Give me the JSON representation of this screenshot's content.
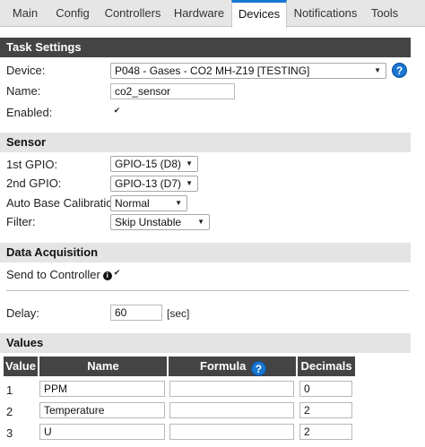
{
  "tabs": [
    {
      "label": "Main",
      "active": false
    },
    {
      "label": "Config",
      "active": false
    },
    {
      "label": "Controllers",
      "active": false
    },
    {
      "label": "Hardware",
      "active": false
    },
    {
      "label": "Devices",
      "active": true
    },
    {
      "label": "Notifications",
      "active": false
    },
    {
      "label": "Tools",
      "active": false
    }
  ],
  "task_settings": {
    "title": "Task Settings",
    "device_label": "Device:",
    "device_value": "P048 - Gases - CO2 MH-Z19 [TESTING]",
    "name_label": "Name:",
    "name_value": "co2_sensor",
    "enabled_label": "Enabled:",
    "enabled_check": "✔"
  },
  "sensor": {
    "title": "Sensor",
    "gpio1_label": "1st GPIO:",
    "gpio1_value": "GPIO-15 (D8)",
    "gpio2_label": "2nd GPIO:",
    "gpio2_value": "GPIO-13 (D7)",
    "abc_label": "Auto Base Calibration:",
    "abc_value": "Normal",
    "filter_label": "Filter:",
    "filter_value": "Skip Unstable"
  },
  "data_acquisition": {
    "title": "Data Acquisition",
    "send_label": "Send to Controller",
    "send_check": "✔",
    "delay_label": "Delay:",
    "delay_value": "60",
    "delay_unit": "[sec]"
  },
  "values": {
    "title": "Values",
    "headers": {
      "value": "Value",
      "name": "Name",
      "formula": "Formula",
      "decimals": "Decimals"
    },
    "rows": [
      {
        "num": "1",
        "name": "PPM",
        "formula": "",
        "decimals": "0"
      },
      {
        "num": "2",
        "name": "Temperature",
        "formula": "",
        "decimals": "2"
      },
      {
        "num": "3",
        "name": "U",
        "formula": "",
        "decimals": "2"
      }
    ]
  },
  "colors": {
    "accent": "#1976d2",
    "header_dark": "#444444",
    "header_light": "#e4e4e4"
  },
  "icons": {
    "help": "question-mark-circle-icon",
    "info": "info-dot-icon",
    "dropdown": "caret-down-icon",
    "checkmark": "checkmark-icon"
  }
}
